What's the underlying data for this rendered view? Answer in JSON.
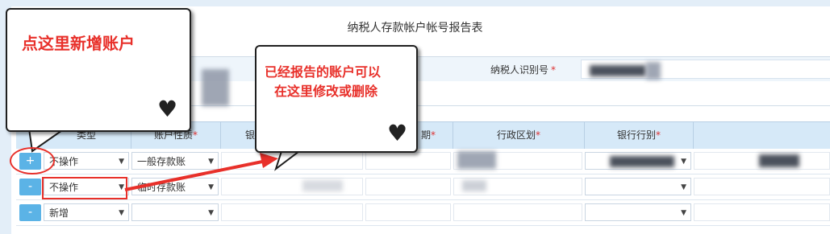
{
  "form": {
    "title": "纳税人存款帐户帐号报告表",
    "taxpayer_id_label": "纳税人识别号",
    "required_mark": "*"
  },
  "table": {
    "headers": [
      {
        "label": "类型",
        "required": false
      },
      {
        "label": "账户性质",
        "required": true
      },
      {
        "label": "银行",
        "required": false
      },
      {
        "label": "期",
        "required": true
      },
      {
        "label": "行政区划",
        "required": true
      },
      {
        "label": "银行行别",
        "required": true
      }
    ],
    "rows": [
      {
        "button": "+",
        "type": "不操作",
        "account_nature": "一般存款账"
      },
      {
        "button": "-",
        "type": "不操作",
        "account_nature": "临时存款账"
      },
      {
        "button": "-",
        "type": "新增",
        "account_nature": ""
      }
    ]
  },
  "callouts": {
    "add_account": "点这里新增账户",
    "modify_line1": "已经报告的账户可以",
    "modify_line2": "在这里修改或删除"
  },
  "icons": {
    "heart": "♥",
    "caret": "▼"
  },
  "colors": {
    "accent_blue": "#5bb3e6",
    "annotation_red": "#e8302a",
    "header_bg": "#d6e9f8"
  }
}
